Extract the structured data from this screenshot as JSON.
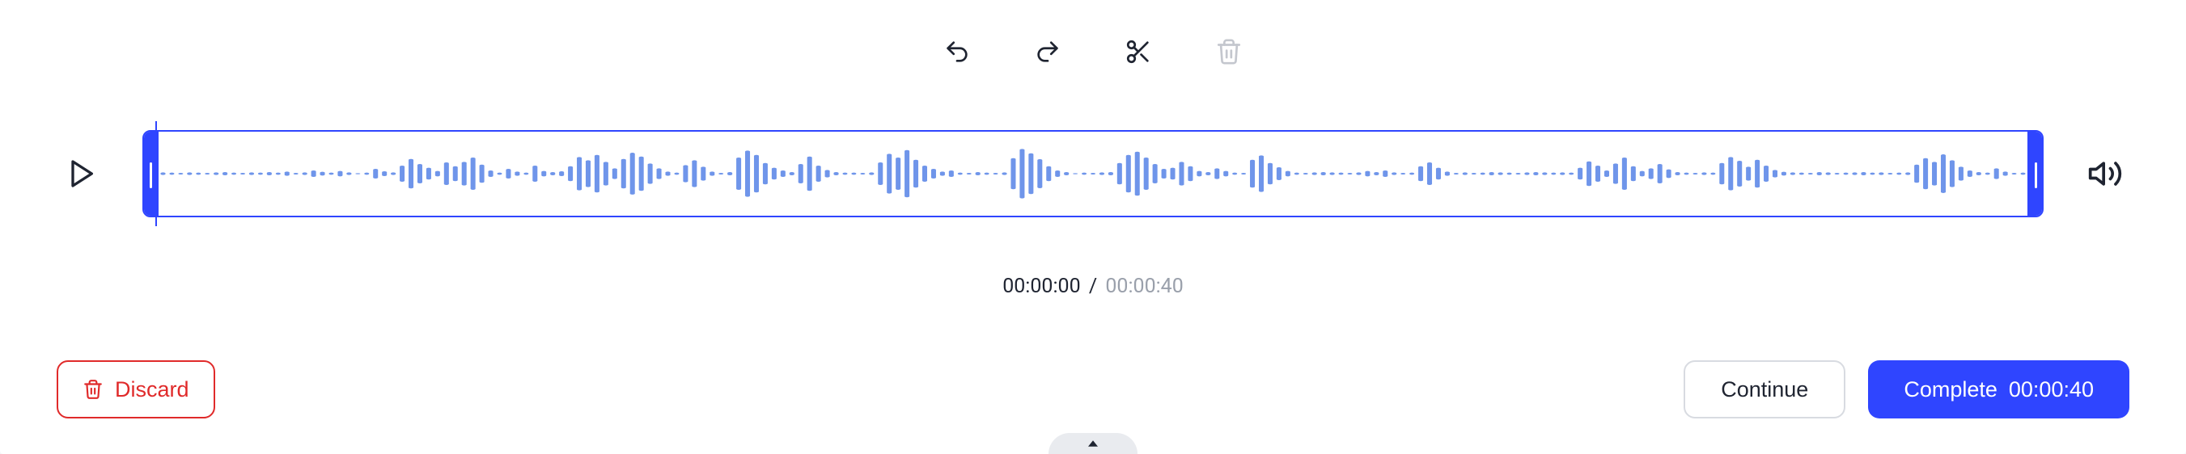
{
  "toolbar": {
    "undo_icon": "undo-icon",
    "redo_icon": "redo-icon",
    "cut_icon": "scissors-icon",
    "delete_icon": "trash-icon"
  },
  "player": {
    "play_icon": "play-icon",
    "volume_icon": "volume-icon",
    "current_time": "00:00:00",
    "separator": "/",
    "total_time": "00:00:40"
  },
  "waveform": {
    "bars": [
      0.05,
      0.04,
      0.03,
      0.05,
      0.04,
      0.03,
      0.05,
      0.06,
      0.04,
      0.03,
      0.05,
      0.04,
      0.06,
      0.04,
      0.08,
      0.03,
      0.05,
      0.12,
      0.07,
      0.04,
      0.1,
      0.05,
      0.02,
      0.04,
      0.18,
      0.09,
      0.05,
      0.3,
      0.55,
      0.36,
      0.22,
      0.1,
      0.42,
      0.28,
      0.44,
      0.6,
      0.34,
      0.12,
      0.04,
      0.18,
      0.08,
      0.04,
      0.3,
      0.1,
      0.06,
      0.09,
      0.28,
      0.62,
      0.5,
      0.7,
      0.44,
      0.2,
      0.55,
      0.78,
      0.64,
      0.38,
      0.2,
      0.08,
      0.04,
      0.32,
      0.5,
      0.26,
      0.08,
      0.03,
      0.06,
      0.6,
      0.86,
      0.7,
      0.4,
      0.22,
      0.12,
      0.06,
      0.36,
      0.64,
      0.3,
      0.14,
      0.06,
      0.04,
      0.04,
      0.03,
      0.05,
      0.42,
      0.74,
      0.6,
      0.88,
      0.52,
      0.3,
      0.18,
      0.08,
      0.12,
      0.04,
      0.03,
      0.06,
      0.04,
      0.03,
      0.05,
      0.58,
      0.92,
      0.76,
      0.54,
      0.28,
      0.12,
      0.06,
      0.02,
      0.04,
      0.03,
      0.05,
      0.06,
      0.4,
      0.7,
      0.82,
      0.6,
      0.36,
      0.18,
      0.22,
      0.44,
      0.28,
      0.1,
      0.06,
      0.2,
      0.1,
      0.04,
      0.03,
      0.52,
      0.68,
      0.4,
      0.24,
      0.1,
      0.04,
      0.03,
      0.05,
      0.06,
      0.05,
      0.04,
      0.03,
      0.05,
      0.1,
      0.06,
      0.12,
      0.05,
      0.03,
      0.04,
      0.28,
      0.42,
      0.22,
      0.08,
      0.03,
      0.05,
      0.03,
      0.04,
      0.06,
      0.05,
      0.04,
      0.03,
      0.05,
      0.06,
      0.05,
      0.04,
      0.05,
      0.04,
      0.22,
      0.46,
      0.3,
      0.12,
      0.38,
      0.6,
      0.28,
      0.1,
      0.2,
      0.36,
      0.16,
      0.06,
      0.04,
      0.03,
      0.05,
      0.04,
      0.4,
      0.62,
      0.48,
      0.26,
      0.52,
      0.3,
      0.14,
      0.07,
      0.05,
      0.04,
      0.03,
      0.06,
      0.05,
      0.03,
      0.04,
      0.05,
      0.06,
      0.04,
      0.05,
      0.03,
      0.04,
      0.05,
      0.34,
      0.58,
      0.44,
      0.72,
      0.5,
      0.26,
      0.12,
      0.06,
      0.04,
      0.2,
      0.08,
      0.03,
      0.04
    ]
  },
  "buttons": {
    "discard_label": "Discard",
    "continue_label": "Continue",
    "complete_prefix": "Complete ",
    "complete_time": "00:00:40"
  }
}
